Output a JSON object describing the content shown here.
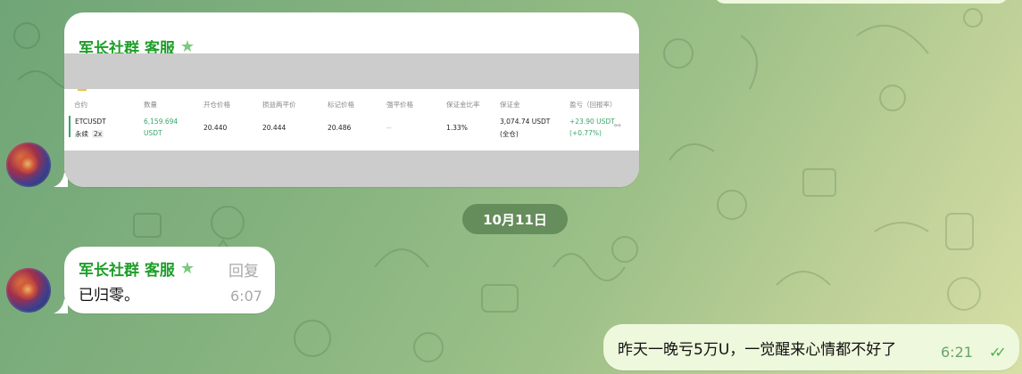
{
  "top_card": {
    "sender": "军长社群 客服",
    "star_icon": "star-icon",
    "table": {
      "headers": [
        "合约",
        "数量",
        "开仓价格",
        "损益两平价",
        "标记价格",
        "强平价格",
        "保证金比率",
        "保证金",
        "盈亏（回报率）"
      ],
      "row": {
        "symbol": "ETCUSDT",
        "type": "永续",
        "leverage": "2x",
        "quantity": "6,159.694",
        "quantity_unit": "USDT",
        "entry_price": "20.440",
        "breakeven_price": "20.444",
        "mark_price": "20.486",
        "liq_price": "--",
        "margin_ratio": "1.33%",
        "margin": "3,074.74 USDT",
        "margin_mode": "(全仓)",
        "pnl": "+23.90 USDT",
        "pnl_pct": "(+0.77%)"
      },
      "share_icon": "share-icon"
    }
  },
  "date_divider": "10月11日",
  "incoming_message": {
    "sender": "军长社群 客服",
    "reply_label": "回复",
    "text": "已归零。",
    "time": "6:07"
  },
  "outgoing_message": {
    "text": "昨天一晚亏5万U，一觉醒来心情都不好了",
    "time": "6:21",
    "status_icon": "double-check-icon"
  },
  "colors": {
    "sender_green": "#1f9e2a",
    "outgoing_bubble": "#eef8dc",
    "pnl_green": "#3aa56a"
  }
}
